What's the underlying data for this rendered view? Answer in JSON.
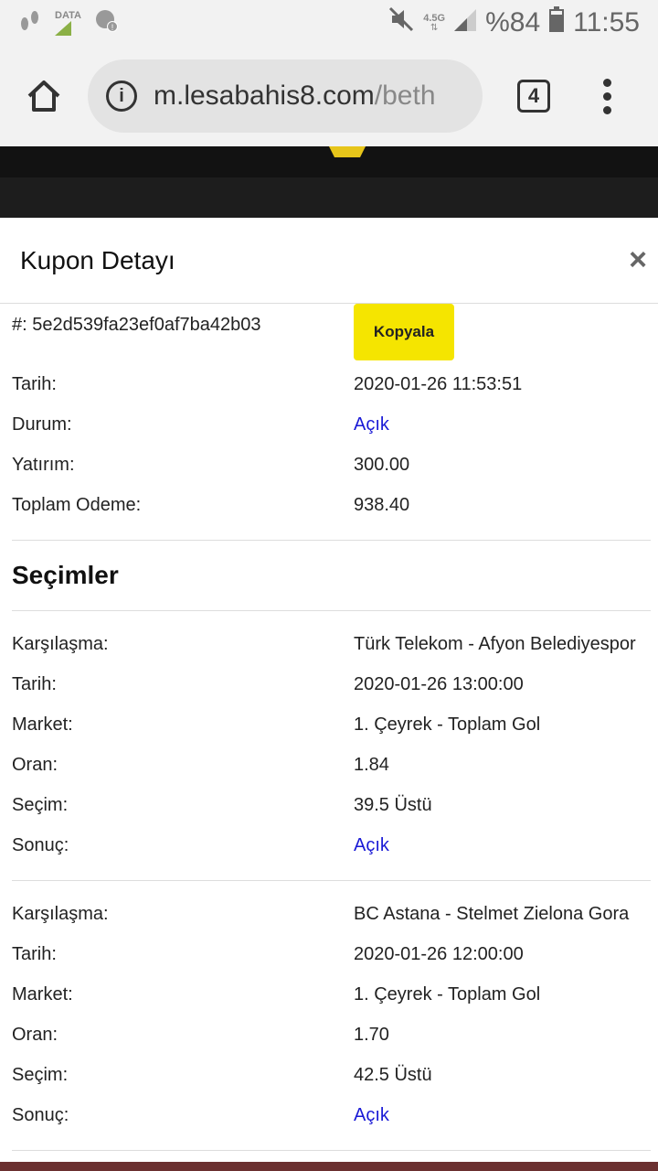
{
  "status_bar": {
    "data_label": "DATA",
    "network": "4.5G",
    "battery": "%84",
    "time": "11:55"
  },
  "browser": {
    "url_domain": "m.lesabahis8.com",
    "url_path": "/beth",
    "tab_count": "4"
  },
  "modal": {
    "title": "Kupon Detayı",
    "close": "×",
    "coupon": {
      "id_label": "#:",
      "id_value": "5e2d539fa23ef0af7ba42b03",
      "copy_label": "Kopyala",
      "rows": [
        {
          "key": "Tarih:",
          "value": "2020-01-26 11:53:51"
        },
        {
          "key": "Durum:",
          "value": "Açık"
        },
        {
          "key": "Yatırım:",
          "value": "300.00"
        },
        {
          "key": "Toplam Odeme:",
          "value": "938.40"
        }
      ]
    },
    "selections_title": "Seçimler",
    "selections": [
      {
        "match_label": "Karşılaşma:",
        "match": "Türk Telekom - Afyon Belediyespor",
        "date_label": "Tarih:",
        "date": "2020-01-26 13:00:00",
        "market_label": "Market:",
        "market": "1. Çeyrek - Toplam Gol",
        "odds_label": "Oran:",
        "odds": "1.84",
        "pick_label": "Seçim:",
        "pick": "39.5 Üstü",
        "result_label": "Sonuç:",
        "result": "Açık"
      },
      {
        "match_label": "Karşılaşma:",
        "match": "BC Astana - Stelmet Zielona Gora",
        "date_label": "Tarih:",
        "date": "2020-01-26 12:00:00",
        "market_label": "Market:",
        "market": "1. Çeyrek - Toplam Gol",
        "odds_label": "Oran:",
        "odds": "1.70",
        "pick_label": "Seçim:",
        "pick": "42.5 Üstü",
        "result_label": "Sonuç:",
        "result": "Açık"
      }
    ]
  },
  "colors": {
    "accent_yellow": "#f5e500",
    "link_blue": "#1a1ad6"
  }
}
